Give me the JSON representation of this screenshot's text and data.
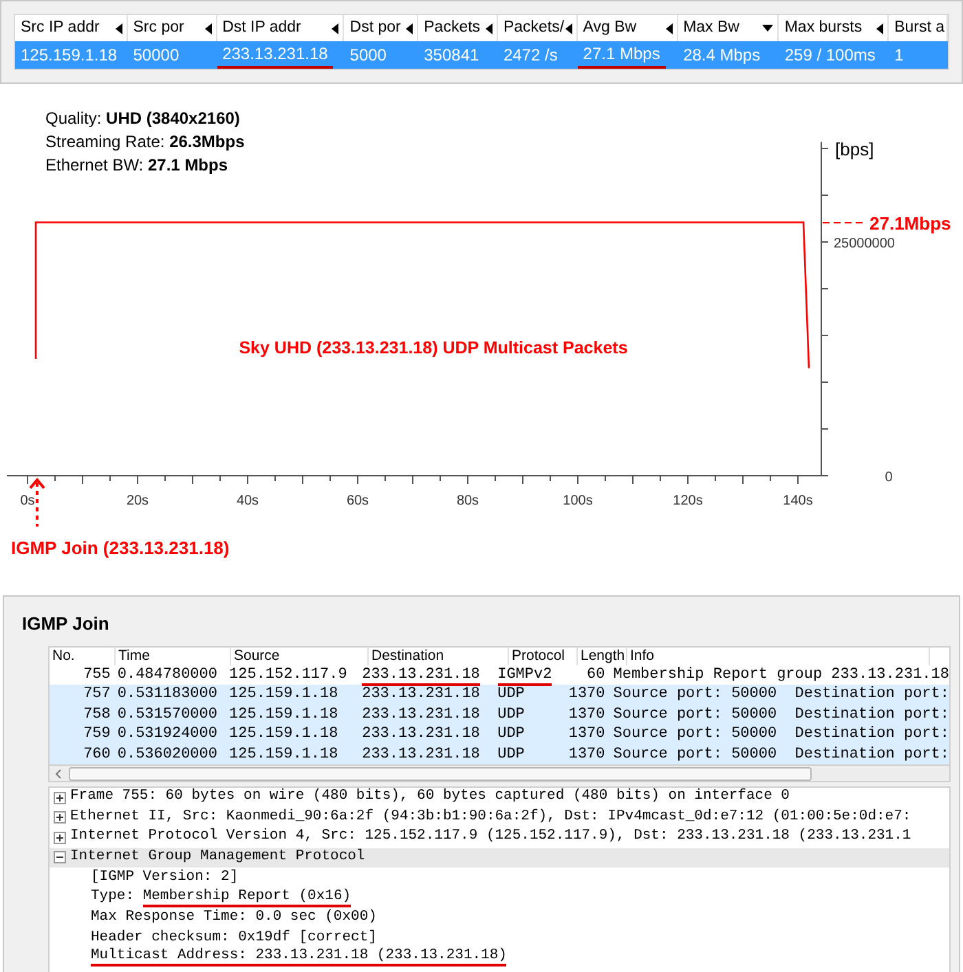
{
  "flow_table": {
    "columns": [
      {
        "label": "Src IP addr",
        "sorted": false
      },
      {
        "label": "Src por",
        "sorted": false
      },
      {
        "label": "Dst IP addr",
        "sorted": false
      },
      {
        "label": "Dst por",
        "sorted": false
      },
      {
        "label": "Packets",
        "sorted": false
      },
      {
        "label": "Packets/",
        "sorted": false
      },
      {
        "label": "Avg Bw",
        "sorted": false
      },
      {
        "label": "Max Bw",
        "sorted": true
      },
      {
        "label": "Max bursts",
        "sorted": false
      },
      {
        "label": "Burst a"
      }
    ],
    "rows": [
      {
        "selected": true,
        "cells": [
          {
            "text": "125.159.1.18",
            "underlined": false
          },
          {
            "text": "50000",
            "underlined": false
          },
          {
            "text": "233.13.231.18",
            "underlined": true
          },
          {
            "text": "5000",
            "underlined": false
          },
          {
            "text": "350841",
            "underlined": false
          },
          {
            "text": "2472 /s",
            "underlined": false
          },
          {
            "text": "27.1 Mbps",
            "underlined": true
          },
          {
            "text": "28.4 Mbps",
            "underlined": false
          },
          {
            "text": "259 / 100ms",
            "underlined": false
          },
          {
            "text": "1",
            "underlined": false
          }
        ]
      }
    ]
  },
  "stream_info": [
    {
      "label": "Quality:",
      "value": "UHD (3840x2160)"
    },
    {
      "label": "Streaming Rate:",
      "value": "26.3Mbps"
    },
    {
      "label": "Ethernet BW:",
      "value": "27.1 Mbps"
    }
  ],
  "chart": {
    "chart_data": {
      "type": "line",
      "title": "Sky UHD (233.13.231.18) UDP Multicast Packets",
      "ylabel": "[bps]",
      "x": [
        1.5,
        1.5,
        141,
        142
      ],
      "xlim": [
        -3.75,
        144.5
      ],
      "ylim": [
        0,
        35700000
      ],
      "series": [
        {
          "color": "#ff0000",
          "values": [
            12500000,
            27100000,
            27100000,
            11500000
          ]
        }
      ],
      "xticks": [
        {
          "value": 0,
          "label": "0s"
        },
        {
          "value": 20,
          "label": "20s"
        },
        {
          "value": 40,
          "label": "40s"
        },
        {
          "value": 60,
          "label": "60s"
        },
        {
          "value": 80,
          "label": "80s"
        },
        {
          "value": 100,
          "label": "100s"
        },
        {
          "value": 120,
          "label": "120s"
        },
        {
          "value": 140,
          "label": "140s"
        }
      ],
      "yticks": [
        0,
        25000000
      ],
      "annotations": [
        "27.1Mbps",
        "IGMP Join (233.13.231.18)"
      ]
    }
  },
  "section_title": "IGMP Join",
  "packet_list": {
    "columns": [
      "No.",
      "Time",
      "Source",
      "Destination",
      "Protocol",
      "Length",
      "Info"
    ],
    "rows": [
      {
        "color": "#ffffff",
        "cells": [
          {
            "text": "755",
            "underlined": false
          },
          {
            "text": "0.484780000",
            "underlined": false
          },
          {
            "text": "125.152.117.9",
            "underlined": false
          },
          {
            "text": "233.13.231.18",
            "underlined": true
          },
          {
            "text": "IGMPv2",
            "underlined": true
          },
          {
            "text": "60",
            "underlined": false
          },
          {
            "text": "Membership Report group 233.13.231.18",
            "underlined": false
          }
        ]
      },
      {
        "color": "#daeeff",
        "cells": [
          {
            "text": "757",
            "underlined": false
          },
          {
            "text": "0.531183000",
            "underlined": false
          },
          {
            "text": "125.159.1.18",
            "underlined": false
          },
          {
            "text": "233.13.231.18",
            "underlined": false
          },
          {
            "text": "UDP",
            "underlined": false
          },
          {
            "text": "1370",
            "underlined": false
          },
          {
            "text": "Source port: 50000  Destination port:",
            "underlined": false
          }
        ]
      },
      {
        "color": "#daeeff",
        "cells": [
          {
            "text": "758",
            "underlined": false
          },
          {
            "text": "0.531570000",
            "underlined": false
          },
          {
            "text": "125.159.1.18",
            "underlined": false
          },
          {
            "text": "233.13.231.18",
            "underlined": false
          },
          {
            "text": "UDP",
            "underlined": false
          },
          {
            "text": "1370",
            "underlined": false
          },
          {
            "text": "Source port: 50000  Destination port:",
            "underlined": false
          }
        ]
      },
      {
        "color": "#daeeff",
        "cells": [
          {
            "text": "759",
            "underlined": false
          },
          {
            "text": "0.531924000",
            "underlined": false
          },
          {
            "text": "125.159.1.18",
            "underlined": false
          },
          {
            "text": "233.13.231.18",
            "underlined": false
          },
          {
            "text": "UDP",
            "underlined": false
          },
          {
            "text": "1370",
            "underlined": false
          },
          {
            "text": "Source port: 50000  Destination port:",
            "underlined": false
          }
        ]
      },
      {
        "color": "#daeeff",
        "cells": [
          {
            "text": "760",
            "underlined": false
          },
          {
            "text": "0.536020000",
            "underlined": false
          },
          {
            "text": "125.159.1.18",
            "underlined": false
          },
          {
            "text": "233.13.231.18",
            "underlined": false
          },
          {
            "text": "UDP",
            "underlined": false
          },
          {
            "text": "1370",
            "underlined": false
          },
          {
            "text": "Source port: 50000  Destination port:",
            "underlined": false
          }
        ]
      }
    ]
  },
  "details": [
    {
      "text": "Frame 755: 60 bytes on wire (480 bits), 60 bytes captured (480 bits) on interface 0",
      "expanded": false,
      "selected": false
    },
    {
      "text": "Ethernet II, Src: Kaonmedi_90:6a:2f (94:3b:b1:90:6a:2f), Dst: IPv4mcast_0d:e7:12 (01:00:5e:0d:e7:",
      "expanded": false,
      "selected": false
    },
    {
      "text": "Internet Protocol Version 4, Src: 125.152.117.9 (125.152.117.9), Dst: 233.13.231.18 (233.13.231.1",
      "expanded": false,
      "selected": false
    },
    {
      "text": "Internet Group Management Protocol",
      "expanded": true,
      "selected": true,
      "children": [
        {
          "text": "[IGMP Version: 2]",
          "underlined": false
        },
        {
          "text": "Type:",
          "value": "Membership Report (0x16)",
          "underlined": true
        },
        {
          "text": "Max Response Time: 0.0 sec (0x00)",
          "underlined": false
        },
        {
          "text": "Header checksum: 0x19df [correct]",
          "underlined": false
        },
        {
          "text": "Multicast Address: 233.13.231.18 (233.13.231.18)",
          "underlined": true
        }
      ]
    }
  ]
}
